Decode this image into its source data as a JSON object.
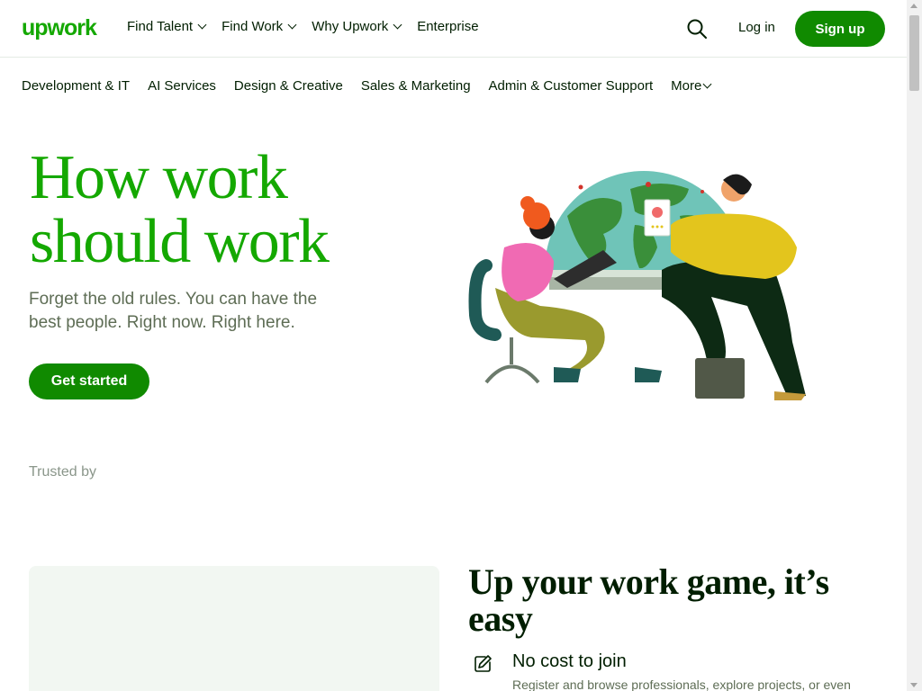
{
  "header": {
    "logo": "upwork",
    "nav": [
      {
        "label": "Find Talent",
        "has_dropdown": true
      },
      {
        "label": "Find Work",
        "has_dropdown": true
      },
      {
        "label": "Why Upwork",
        "has_dropdown": true
      },
      {
        "label": "Enterprise",
        "has_dropdown": false
      }
    ],
    "search_icon": "search-icon",
    "login_label": "Log in",
    "signup_label": "Sign up"
  },
  "categories": [
    "Development & IT",
    "AI Services",
    "Design & Creative",
    "Sales & Marketing",
    "Admin & Customer Support",
    "More"
  ],
  "hero": {
    "title_line1": "How work",
    "title_line2": "should work",
    "subtitle": "Forget the old rules. You can have the best people. Right now. Right here.",
    "cta_label": "Get started"
  },
  "trusted_label": "Trusted by",
  "section": {
    "title": "Up your work game, it’s easy",
    "features": [
      {
        "icon": "edit-icon",
        "title": "No cost to join",
        "description": "Register and browse professionals, explore projects, or even"
      }
    ]
  },
  "colors": {
    "brand_green": "#14a800",
    "button_green": "#108a00",
    "text_dark": "#001e00",
    "text_muted": "#5e6d55",
    "panel_bg": "#f2f7f2"
  }
}
